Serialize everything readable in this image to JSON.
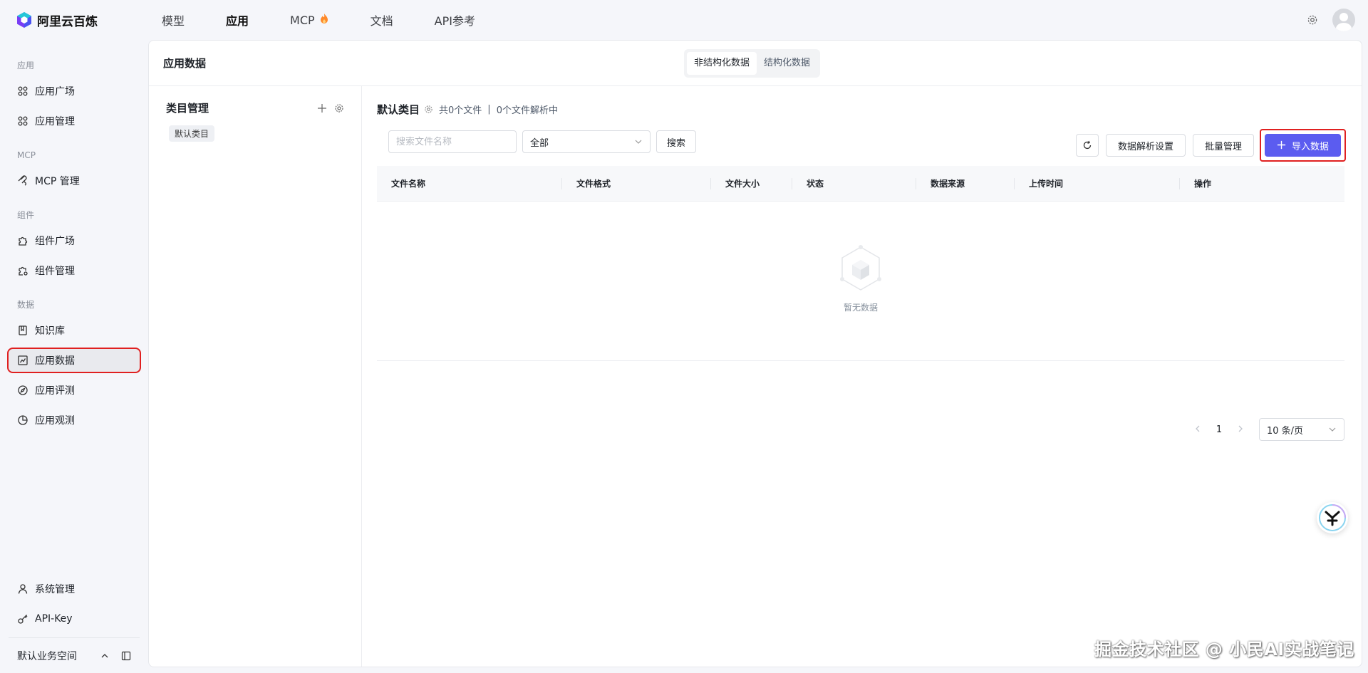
{
  "brand": {
    "name": "阿里云百炼"
  },
  "topnav": {
    "items": [
      {
        "label": "模型"
      },
      {
        "label": "应用"
      },
      {
        "label": "MCP"
      },
      {
        "label": "文档"
      },
      {
        "label": "API参考"
      }
    ],
    "active": "应用"
  },
  "sidebar": {
    "groups": [
      {
        "label": "应用"
      },
      {
        "label": "MCP"
      },
      {
        "label": "组件"
      },
      {
        "label": "数据"
      }
    ],
    "items": [
      {
        "label": "应用广场"
      },
      {
        "label": "应用管理"
      },
      {
        "label": "MCP 管理"
      },
      {
        "label": "组件广场"
      },
      {
        "label": "组件管理"
      },
      {
        "label": "知识库"
      },
      {
        "label": "应用数据"
      },
      {
        "label": "应用评测"
      },
      {
        "label": "应用观测"
      },
      {
        "label": "系统管理"
      },
      {
        "label": "API-Key"
      }
    ],
    "workspace": "默认业务空间"
  },
  "main": {
    "title": "应用数据",
    "tabs": [
      {
        "label": "非结构化数据"
      },
      {
        "label": "结构化数据"
      }
    ]
  },
  "category": {
    "title": "类目管理",
    "tag": "默认类目"
  },
  "content": {
    "title": "默认类目",
    "file_count": "共0个文件",
    "separator": "|",
    "parsing": "0个文件解析中",
    "search_placeholder": "搜索文件名称",
    "filter_value": "全部",
    "search_btn": "搜索",
    "parse_settings_btn": "数据解析设置",
    "batch_btn": "批量管理",
    "import_btn": "导入数据",
    "columns": [
      "文件名称",
      "文件格式",
      "文件大小",
      "状态",
      "数据来源",
      "上传时间",
      "操作"
    ],
    "empty": "暂无数据"
  },
  "pagination": {
    "page": "1",
    "page_size": "10 条/页"
  },
  "watermark": "掘金技术社区 @ 小民AI实战笔记",
  "colors": {
    "primary": "#5b5cf0",
    "highlight": "#e02020"
  }
}
